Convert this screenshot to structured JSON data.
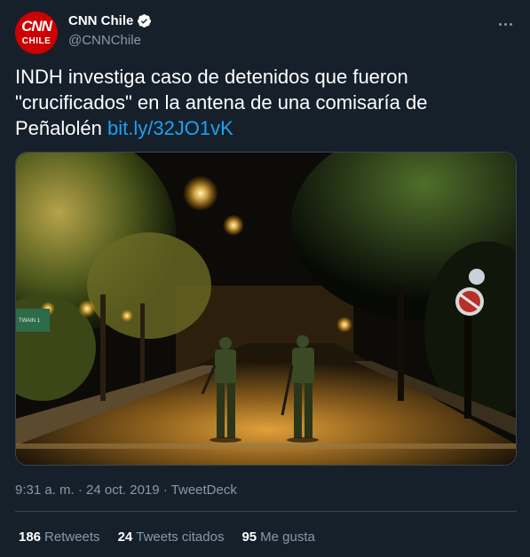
{
  "header": {
    "avatar_brand": "CNN",
    "avatar_sub": "CHILE",
    "display_name": "CNN Chile",
    "handle": "@CNNChile",
    "verified_icon": "verified-badge-icon",
    "more_icon": "more-options-icon"
  },
  "tweet": {
    "text": "INDH investiga caso de detenidos que fueron \"crucificados\" en la antena de una comisaría de Peñalolén ",
    "link": "bit.ly/32JO1vK"
  },
  "media": {
    "sign_text": "TWAIN 1"
  },
  "meta": {
    "timestamp": "9:31 a. m. · 24 oct. 2019 · TweetDeck"
  },
  "stats": {
    "retweets_count": "186",
    "retweets_label": "Retweets",
    "quotes_count": "24",
    "quotes_label": "Tweets citados",
    "likes_count": "95",
    "likes_label": "Me gusta"
  },
  "colors": {
    "background": "#15202b",
    "link": "#1da1f2",
    "secondary_text": "#8899a6",
    "border": "#38444d",
    "brand_red": "#cc0000"
  }
}
